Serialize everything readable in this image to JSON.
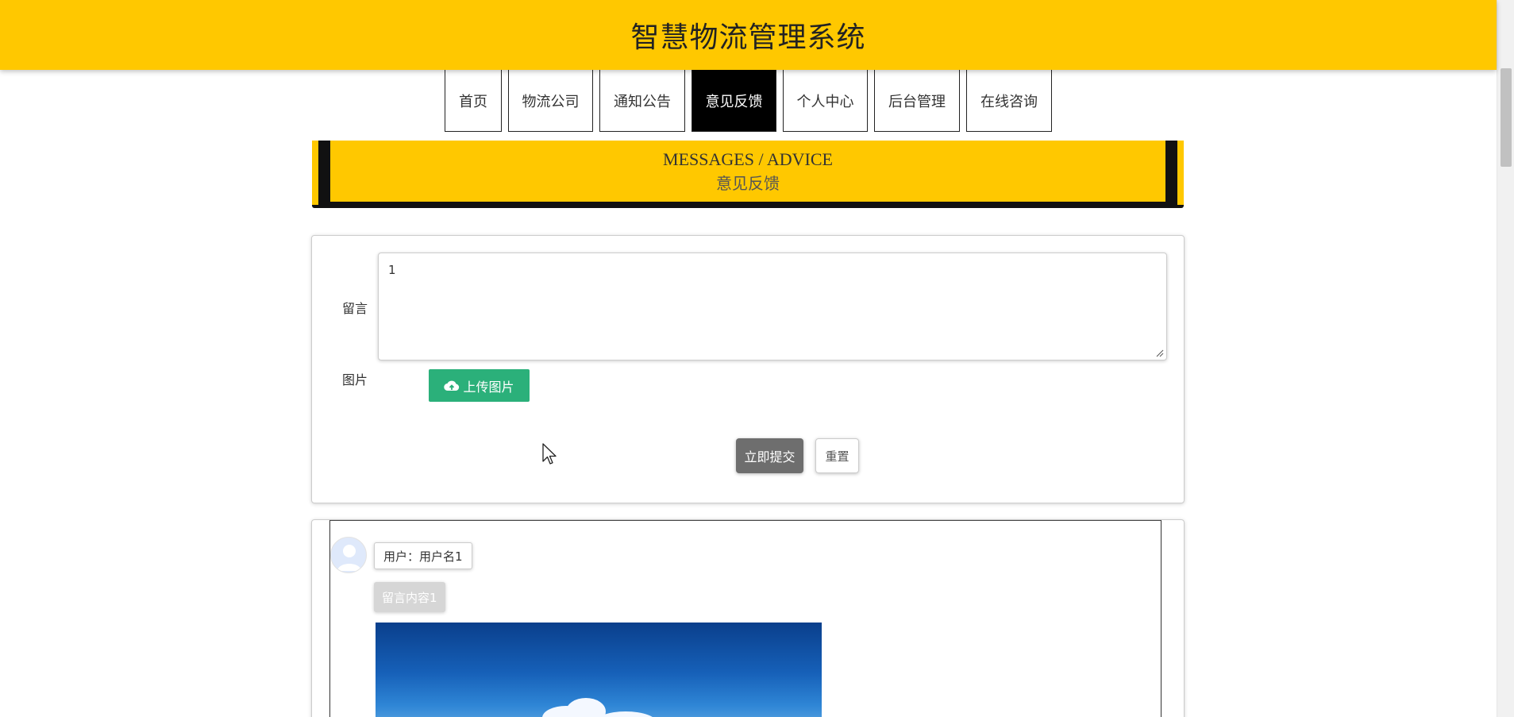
{
  "site": {
    "title": "智慧物流管理系统"
  },
  "nav": {
    "items": [
      {
        "label": "首页"
      },
      {
        "label": "物流公司"
      },
      {
        "label": "通知公告"
      },
      {
        "label": "意见反馈",
        "active": true
      },
      {
        "label": "个人中心"
      },
      {
        "label": "后台管理"
      },
      {
        "label": "在线咨询"
      }
    ]
  },
  "banner": {
    "title_en": "MESSAGES / ADVICE",
    "title_cn": "意见反馈"
  },
  "form": {
    "message_label": "留言",
    "message_value": "1",
    "image_label": "图片",
    "upload_label": "上传图片",
    "submit_label": "立即提交",
    "reset_label": "重置"
  },
  "messages": [
    {
      "user": "用户：用户名1",
      "content": "留言内容1"
    }
  ],
  "colors": {
    "brand": "#ffc800",
    "nav_active": "#000000",
    "upload": "#2bb07a",
    "submit": "#6e6e6e"
  }
}
